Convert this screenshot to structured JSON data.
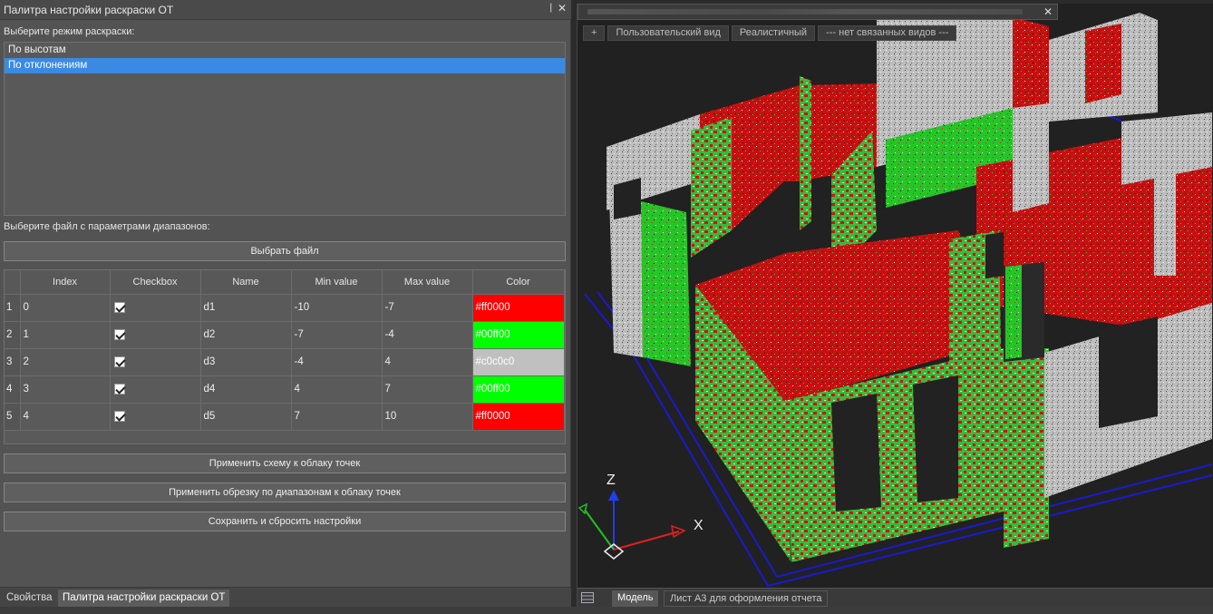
{
  "palette": {
    "title": "Палитра настройки раскраски ОТ",
    "pin_glyph": "❘",
    "close_glyph": "✕",
    "mode_label": "Выберите режим раскраски:",
    "modes": [
      "По высотам",
      "По отклонениям"
    ],
    "selected_mode": "По отклонениям",
    "file_label": "Выберите файл с параметрами диапазонов:",
    "choose_file_button": "Выбрать файл",
    "table": {
      "headers": [
        "Index",
        "Checkbox",
        "Name",
        "Min value",
        "Max value",
        "Color"
      ],
      "rows": [
        {
          "row": "1",
          "index": "0",
          "checked": true,
          "name": "d1",
          "min": "-10",
          "max": "-7",
          "color": "#ff0000"
        },
        {
          "row": "2",
          "index": "1",
          "checked": true,
          "name": "d2",
          "min": "-7",
          "max": "-4",
          "color": "#00ff00"
        },
        {
          "row": "3",
          "index": "2",
          "checked": true,
          "name": "d3",
          "min": "-4",
          "max": "4",
          "color": "#c0c0c0"
        },
        {
          "row": "4",
          "index": "3",
          "checked": true,
          "name": "d4",
          "min": "4",
          "max": "7",
          "color": "#00ff00"
        },
        {
          "row": "5",
          "index": "4",
          "checked": true,
          "name": "d5",
          "min": "7",
          "max": "10",
          "color": "#ff0000"
        }
      ]
    },
    "apply_scheme_button": "Применить схему к облаку точек",
    "apply_crop_button": "Применить обрезку по диапазонам к облаку точек",
    "save_reset_button": "Сохранить и сбросить настройки"
  },
  "bottom_tabs": [
    "Свойства",
    "Палитра настройки раскраски ОТ"
  ],
  "active_bottom_tab": "Палитра настройки раскраски ОТ",
  "viewport": {
    "close_glyph": "✕",
    "toolbar": [
      "+",
      "Пользовательский вид",
      "Реалистичный",
      "--- нет связанных видов ---"
    ],
    "axes": {
      "z": "Z",
      "x": "X"
    },
    "model_tabs": [
      "Модель",
      "Лист А3 для оформления отчета"
    ],
    "active_model_tab": "Модель"
  },
  "colors": {
    "accent": "#3a8ae3",
    "deviation_red": "#ff0000",
    "deviation_green": "#00ff00",
    "deviation_grey": "#c0c0c0",
    "outline_blue": "#1a1ad0"
  }
}
